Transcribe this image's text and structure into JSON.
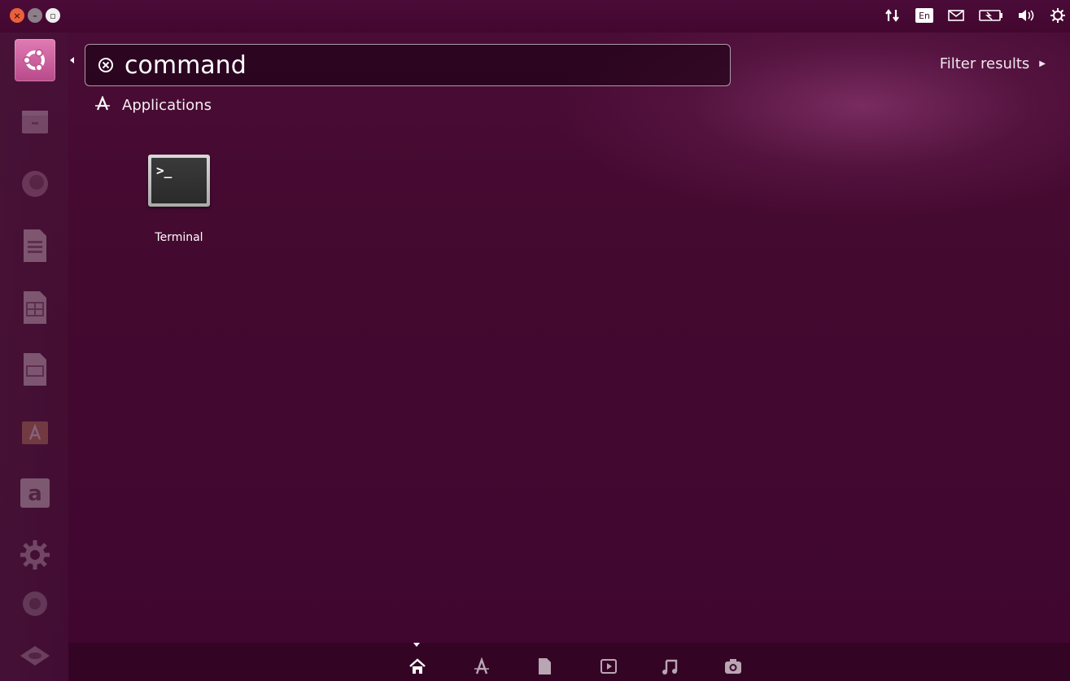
{
  "window_controls": {
    "close": "×",
    "minimize": "–",
    "maximize": "▫"
  },
  "indicators": {
    "keyboard_layout": "En"
  },
  "search": {
    "query": "command"
  },
  "filter": {
    "label": "Filter results"
  },
  "results": {
    "category": "Applications",
    "items": [
      {
        "label": "Terminal",
        "icon": "terminal-icon"
      }
    ]
  },
  "launcher": {
    "items": [
      "ubuntu-dash-icon",
      "files-icon",
      "firefox-icon",
      "libreoffice-writer-icon",
      "libreoffice-calc-icon",
      "libreoffice-impress-icon",
      "software-center-icon",
      "amazon-icon",
      "system-settings-icon",
      "workspace-switcher-icon",
      "trash-icon"
    ]
  },
  "lenses": [
    "home-lens-icon",
    "applications-lens-icon",
    "files-lens-icon",
    "video-lens-icon",
    "music-lens-icon",
    "photos-lens-icon"
  ],
  "colors": {
    "background": "#44092f",
    "accent": "#b84a8a"
  }
}
